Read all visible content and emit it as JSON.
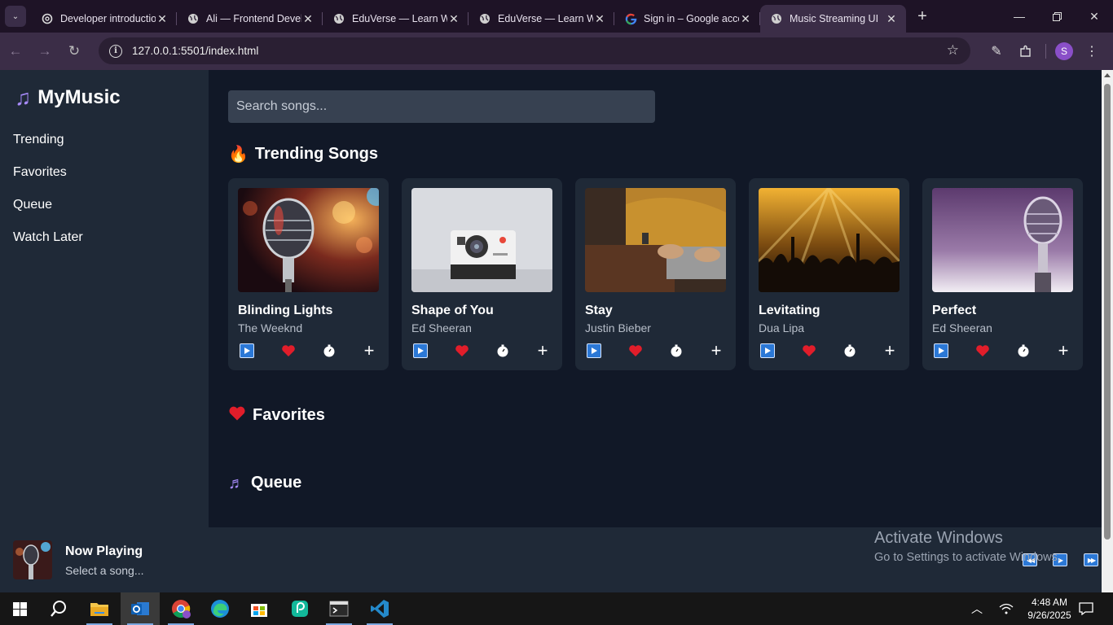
{
  "browser": {
    "tabs": [
      {
        "title": "Developer introductio",
        "favicon": "chatgpt-icon",
        "active": false
      },
      {
        "title": "Ali — Frontend Devel",
        "favicon": "globe-icon",
        "active": false
      },
      {
        "title": "EduVerse — Learn Wi",
        "favicon": "globe-icon",
        "active": false
      },
      {
        "title": "EduVerse — Learn Wi",
        "favicon": "globe-icon",
        "active": false
      },
      {
        "title": "Sign in – Google acco",
        "favicon": "google-icon",
        "active": false
      },
      {
        "title": "Music Streaming UI",
        "favicon": "globe-icon",
        "active": true
      }
    ],
    "url": "127.0.0.1:5501/index.html",
    "profile_initial": "S"
  },
  "sidebar": {
    "brand_icon": "music-note-icon",
    "brand": "MyMusic",
    "nav": [
      "Trending",
      "Favorites",
      "Queue",
      "Watch Later"
    ]
  },
  "search": {
    "placeholder": "Search songs..."
  },
  "sections": {
    "trending": {
      "icon": "fire-icon",
      "glyph": "🔥",
      "title": "Trending Songs"
    },
    "favorites": {
      "icon": "heart-icon",
      "glyph": "❤️",
      "title": "Favorites"
    },
    "queue": {
      "icon": "music-notes-icon",
      "glyph": "🎶",
      "title": "Queue"
    }
  },
  "songs": [
    {
      "title": "Blinding Lights",
      "artist": "The Weeknd",
      "art": "microphone-bokeh"
    },
    {
      "title": "Shape of You",
      "artist": "Ed Sheeran",
      "art": "instant-camera"
    },
    {
      "title": "Stay",
      "artist": "Justin Bieber",
      "art": "laptop-sweater"
    },
    {
      "title": "Levitating",
      "artist": "Dua Lipa",
      "art": "concert-crowd"
    },
    {
      "title": "Perfect",
      "artist": "Ed Sheeran",
      "art": "microphone-purple"
    }
  ],
  "song_actions": [
    "play-icon",
    "heart-icon",
    "stopwatch-icon",
    "plus-icon"
  ],
  "player": {
    "title": "Now Playing",
    "subtitle": "Select a song...",
    "controls": [
      "previous-icon",
      "play-icon",
      "next-icon"
    ]
  },
  "watermark": {
    "line1": "Activate Windows",
    "line2": "Go to Settings to activate Windows."
  },
  "taskbar": {
    "apps": [
      "start-icon",
      "search-icon",
      "file-explorer-icon",
      "outlook-icon",
      "chrome-icon",
      "edge-icon",
      "store-icon",
      "app-icon",
      "terminal-icon",
      "vscode-icon"
    ],
    "time": "4:48 AM",
    "date": "9/26/2025"
  },
  "colors": {
    "bg": "#111827",
    "panel": "#1f2937",
    "input": "#374151",
    "accent": "#a78bfa",
    "heart": "#e11d2a",
    "play": "#2b78d6"
  }
}
